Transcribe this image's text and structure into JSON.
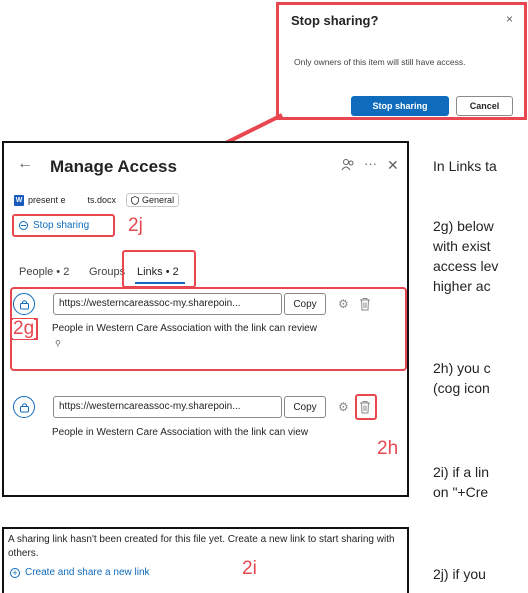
{
  "dialog": {
    "title": "Stop sharing?",
    "close_glyph": "×",
    "message": "Only owners of this item will still have access.",
    "primary_label": "Stop sharing",
    "cancel_label": "Cancel"
  },
  "panel": {
    "back_glyph": "←",
    "title": "Manage Access",
    "more_glyph": "···",
    "close_glyph": "✕",
    "file_name": "present e",
    "file_name_tail": "ts.docx",
    "sensitivity": "General",
    "stop_sharing_label": "Stop sharing",
    "tabs": [
      {
        "label": "People • 2"
      },
      {
        "label": "Groups"
      },
      {
        "label": "Links • 2"
      }
    ],
    "links": [
      {
        "url": "https://westerncareassoc-my.sharepoin...",
        "copy_label": "Copy",
        "description": "People in Western Care Association with the link can review"
      },
      {
        "url": "https://westerncareassoc-my.sharepoin...",
        "copy_label": "Copy",
        "description": "People in Western Care Association with the link can view"
      }
    ]
  },
  "annotations": {
    "step_2j": "2j",
    "step_2g": "2g",
    "step_2h": "2h",
    "step_2i": "2i",
    "highlight_color": "#e8474f"
  },
  "create_panel": {
    "message": "A sharing link hasn't been created for this file yet. Create a new link to start sharing with others.",
    "create_link_label": "Create and share a new link"
  },
  "instructions": [
    "In Links ta",
    "2g) below",
    "with exist",
    "access lev",
    "higher ac",
    "2h) you c",
    "(cog icon",
    "2i) if a lin",
    "on \"+Cre",
    "2j) if you"
  ],
  "icons": {
    "lock": "lock-icon",
    "gear": "gear-icon",
    "trash": "trash-icon",
    "people": "people-icon",
    "word": "word-icon",
    "shield": "shield-icon"
  }
}
